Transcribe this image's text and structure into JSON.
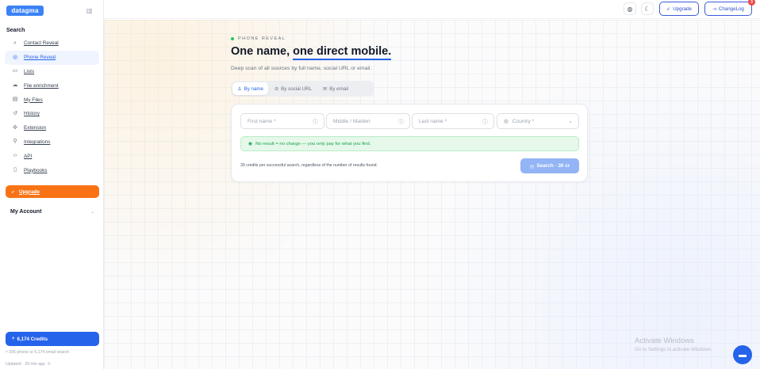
{
  "brand": {
    "logo_text": "datagma",
    "accent": "#3b82f6"
  },
  "sidebar": {
    "section_title": "Search",
    "items": [
      {
        "label": "Contact Reveal",
        "icon": "search-icon",
        "active": false
      },
      {
        "label": "Phone Reveal",
        "icon": "phone-target-icon",
        "active": true
      },
      {
        "label": "Lists",
        "icon": "folder-icon",
        "active": false
      },
      {
        "label": "File enrichment",
        "icon": "cloud-icon",
        "active": false
      },
      {
        "label": "My Files",
        "icon": "file-icon",
        "active": false
      },
      {
        "label": "History",
        "icon": "history-icon",
        "active": false
      },
      {
        "label": "Extension",
        "icon": "puzzle-icon",
        "active": false
      },
      {
        "label": "Integrations",
        "icon": "plug-icon",
        "active": false
      },
      {
        "label": "API",
        "icon": "code-icon",
        "active": false
      },
      {
        "label": "Playbooks",
        "icon": "book-icon",
        "active": false
      }
    ],
    "upgrade_label": "Upgrade",
    "account_label": "My Account",
    "credits_label": "6,174 Credits",
    "credits_note": "≈ 205 phone or 6,174 email search",
    "updated_text": "Updated · 29 min ago"
  },
  "topbar": {
    "upgrade_label": "Upgrade",
    "changelog_label": "ChangeLog",
    "changelog_badge": "3"
  },
  "main": {
    "eyebrow": "PHONE REVEAL",
    "headline_part1": "One name, ",
    "headline_part2": "one direct mobile.",
    "subtitle": "Deep scan of all sources by full name, social URL or email.",
    "tabs": [
      {
        "label": "By name",
        "active": true
      },
      {
        "label": "By social URL",
        "active": false
      },
      {
        "label": "By email",
        "active": false
      }
    ],
    "fields": {
      "first_name": "First name *",
      "middle_name": "Middle / Maiden",
      "last_name": "Last name *",
      "country": "Country *"
    },
    "notice": "No result = no charge — you only pay for what you find.",
    "foot_note": "30 credits per successful search, regardless of the number of results found.",
    "search_label": "Search · 30 cr"
  },
  "watermark": {
    "line1": "Activate Windows",
    "line2": "Go to Settings to activate Windows."
  }
}
